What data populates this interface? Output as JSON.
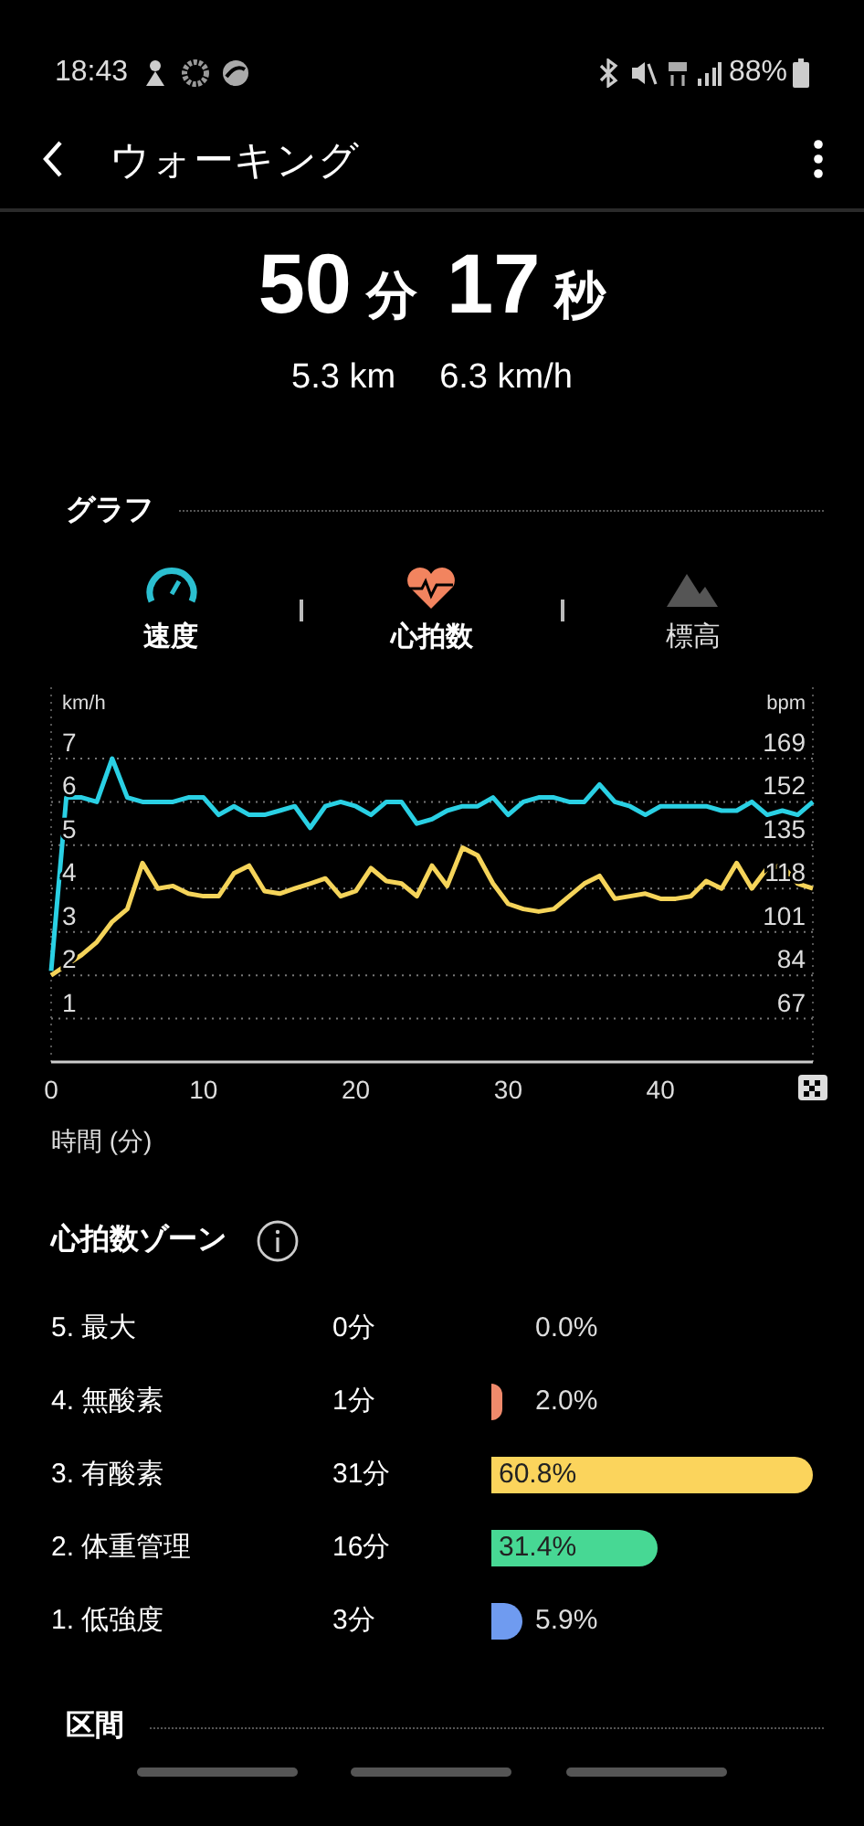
{
  "status_bar": {
    "time": "18:43",
    "battery": "88%"
  },
  "header": {
    "title": "ウォーキング"
  },
  "summary": {
    "minutes": "50",
    "minutes_unit": "分",
    "seconds": "17",
    "seconds_unit": "秒",
    "distance": "5.3 km",
    "speed": "6.3 km/h"
  },
  "graph": {
    "title": "グラフ",
    "tabs": [
      {
        "kind": "speed",
        "label": "速度",
        "selected": true
      },
      {
        "kind": "heart",
        "label": "心拍数",
        "selected": true
      },
      {
        "kind": "elevation",
        "label": "標高",
        "selected": false
      }
    ],
    "chart_data": {
      "type": "line",
      "ylabel": "km/h",
      "y2label": "bpm",
      "xlabel": "時間 (分)",
      "x": [
        0,
        1,
        2,
        3,
        4,
        5,
        6,
        7,
        8,
        9,
        10,
        11,
        12,
        13,
        14,
        15,
        16,
        17,
        18,
        19,
        20,
        21,
        22,
        23,
        24,
        25,
        26,
        27,
        28,
        29,
        30,
        31,
        32,
        33,
        34,
        35,
        36,
        37,
        38,
        39,
        40,
        41,
        42,
        43,
        44,
        45,
        46,
        47,
        48,
        49,
        50
      ],
      "xlim": [
        0,
        50
      ],
      "ylim": [
        0,
        7
      ],
      "xticks": [
        0,
        10,
        20,
        30,
        40
      ],
      "yticks": [
        1,
        2,
        3,
        4,
        5,
        6,
        7
      ],
      "y2lim": [
        50,
        169
      ],
      "grid": true,
      "y2ticks": [
        67,
        84,
        101,
        118,
        135,
        152,
        169
      ],
      "series": [
        {
          "color": "#2ad0e4",
          "values": [
            2.1,
            6.1,
            6.1,
            6.0,
            7.0,
            6.1,
            6.0,
            6.0,
            6.0,
            6.1,
            6.1,
            5.7,
            5.9,
            5.7,
            5.7,
            5.8,
            5.9,
            5.4,
            5.9,
            6.0,
            5.9,
            5.7,
            6.0,
            6.0,
            5.5,
            5.6,
            5.8,
            5.9,
            5.9,
            6.1,
            5.7,
            6.0,
            6.1,
            6.1,
            6.0,
            6.0,
            6.4,
            6.0,
            5.9,
            5.7,
            5.9,
            5.9,
            5.9,
            5.9,
            5.8,
            5.8,
            6.0,
            5.7,
            5.8,
            5.7,
            6.0
          ]
        },
        {
          "axis": "y2",
          "color": "#f5d45a",
          "values": [
            84,
            88,
            92,
            97,
            105,
            110,
            128,
            118,
            119,
            116,
            115,
            115,
            124,
            127,
            117,
            116,
            118,
            120,
            122,
            115,
            117,
            126,
            121,
            120,
            115,
            127,
            119,
            134,
            131,
            120,
            112,
            110,
            109,
            110,
            115,
            120,
            123,
            114,
            115,
            116,
            114,
            114,
            115,
            121,
            118,
            128,
            118,
            126,
            127,
            120,
            118
          ]
        }
      ]
    }
  },
  "zones": {
    "title": "心拍数ゾーン",
    "items": [
      {
        "name": "5. 最大",
        "time": "0分",
        "percent": "0.0%"
      },
      {
        "name": "4. 無酸素",
        "time": "1分",
        "percent": "2.0%",
        "color": "#f08a6c"
      },
      {
        "name": "3. 有酸素",
        "time": "31分",
        "percent": "60.8%",
        "color": "#fbd45c"
      },
      {
        "name": "2. 体重管理",
        "time": "16分",
        "percent": "31.4%",
        "color": "#47d894"
      },
      {
        "name": "1. 低強度",
        "time": "3分",
        "percent": "5.9%",
        "color": "#6f9bf0"
      }
    ]
  },
  "intervals": {
    "title": "区間"
  }
}
